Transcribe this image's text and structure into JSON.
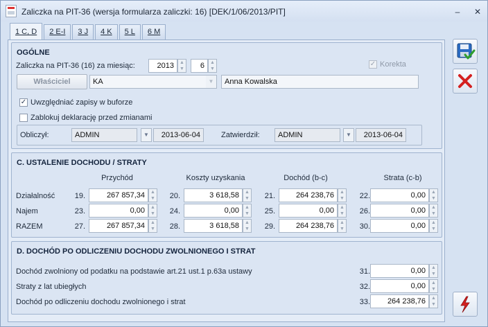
{
  "window": {
    "title": "Zaliczka na PIT-36 (wersja formularza zaliczki: 16) [DEK/1/06/2013/PIT]",
    "minimize": "–",
    "close": "✕"
  },
  "tabs": [
    "1 C, D",
    "2 E-I",
    "3 J",
    "4 K",
    "5 L",
    "6 M"
  ],
  "ogolne": {
    "heading": "OGÓLNE",
    "month_label": "Zaliczka na PIT-36 (16) za miesiąc:",
    "year": "2013",
    "month": "6",
    "korekta_label": "Korekta",
    "owner_button": "Właściciel",
    "owner_code": "KA",
    "owner_name": "Anna Kowalska",
    "buffer_label": "Uwzględniać zapisy w buforze",
    "buffer_checked": true,
    "lock_label": "Zablokuj deklarację przed zmianami",
    "lock_checked": false,
    "calculated_label": "Obliczył:",
    "calculated_user": "ADMIN",
    "calculated_date": "2013-06-04",
    "approved_label": "Zatwierdził:",
    "approved_user": "ADMIN",
    "approved_date": "2013-06-04"
  },
  "sectionC": {
    "heading": "C. USTALENIE DOCHODU / STRATY",
    "headers": [
      "Przychód",
      "Koszty uzyskania",
      "Dochód (b-c)",
      "Strata (c-b)"
    ],
    "rows": [
      {
        "label": "Działalność",
        "cells": [
          {
            "num": "19.",
            "value": "267 857,34"
          },
          {
            "num": "20.",
            "value": "3 618,58"
          },
          {
            "num": "21.",
            "value": "264 238,76"
          },
          {
            "num": "22.",
            "value": "0,00"
          }
        ]
      },
      {
        "label": "Najem",
        "cells": [
          {
            "num": "23.",
            "value": "0,00"
          },
          {
            "num": "24.",
            "value": "0,00"
          },
          {
            "num": "25.",
            "value": "0,00"
          },
          {
            "num": "26.",
            "value": "0,00"
          }
        ]
      },
      {
        "label": "RAZEM",
        "cells": [
          {
            "num": "27.",
            "value": "267 857,34"
          },
          {
            "num": "28.",
            "value": "3 618,58"
          },
          {
            "num": "29.",
            "value": "264 238,76"
          },
          {
            "num": "30.",
            "value": "0,00"
          }
        ]
      }
    ]
  },
  "sectionD": {
    "heading": "D. DOCHÓD PO ODLICZENIU DOCHODU ZWOLNIONEGO I STRAT",
    "rows": [
      {
        "label": "Dochód zwolniony od podatku na podstawie art.21 ust.1 p.63a ustawy",
        "num": "31.",
        "value": "0,00"
      },
      {
        "label": "Straty z lat ubiegłych",
        "num": "32.",
        "value": "0,00"
      },
      {
        "label": "Dochód po odliczeniu dochodu zwolnionego i strat",
        "num": "33.",
        "value": "264 238,76"
      }
    ]
  },
  "colors": {
    "save": "#2b6cc4",
    "cancel": "#d42020",
    "lightning": "#d42020"
  }
}
